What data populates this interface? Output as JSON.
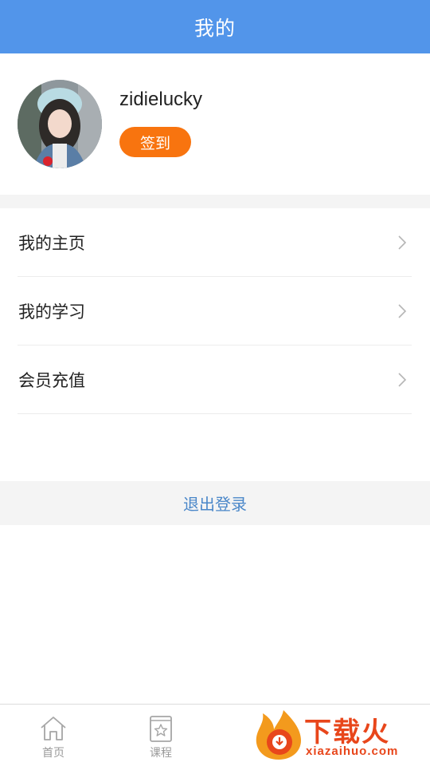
{
  "header": {
    "title": "我的"
  },
  "profile": {
    "username": "zidielucky",
    "signin_label": "签到"
  },
  "menu": {
    "items": [
      {
        "label": "我的主页"
      },
      {
        "label": "我的学习"
      },
      {
        "label": "会员充值"
      }
    ]
  },
  "logout": {
    "label": "退出登录"
  },
  "tabbar": {
    "tabs": [
      {
        "label": "首页",
        "icon": "home-icon"
      },
      {
        "label": "课程",
        "icon": "book-star-icon"
      }
    ]
  },
  "watermark": {
    "brand": "下载火",
    "url": "xiazaihuo.com"
  },
  "colors": {
    "header": "#5295ea",
    "accent_orange": "#f8740f",
    "link_blue": "#4a87c9"
  }
}
